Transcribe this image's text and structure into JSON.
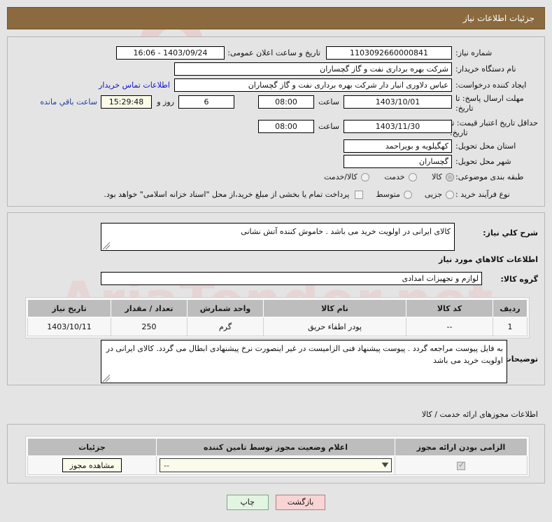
{
  "header": {
    "title": "جزئیات اطلاعات نیاز"
  },
  "form": {
    "need_number_label": "شماره نیاز:",
    "need_number_value": "1103092660000841",
    "announce_label": "تاریخ و ساعت اعلان عمومی:",
    "announce_value": "1403/09/24 - 16:06",
    "buyer_org_label": "نام دستگاه خریدار:",
    "buyer_org_value": "شرکت بهره برداری نفت و گاز گچساران",
    "requester_label": "ایجاد کننده درخواست:",
    "requester_value": "عباس دلاوری انبار دار شرکت بهره برداری نفت و گاز گچساران",
    "contact_link": "اطلاعات تماس خریدار",
    "deadline_label": "مهلت ارسال پاسخ: تا تاریخ:",
    "deadline_date": "1403/10/01",
    "hour_label": "ساعت",
    "deadline_time": "08:00",
    "days_remaining": "6",
    "days_and_label": "روز و",
    "clock_remaining": "15:29:48",
    "remaining_suffix": "ساعت باقي مانده",
    "price_validity_label": "حداقل تاریخ اعتبار قیمت: تا تاریخ:",
    "price_validity_date": "1403/11/30",
    "price_validity_time": "08:00",
    "province_label": "استان محل تحویل:",
    "province_value": "کهگیلویه و بویراحمد",
    "city_label": "شهر محل تحویل:",
    "city_value": "گچساران",
    "category_label": "طبقه بندی موضوعی:",
    "category_options": [
      {
        "label": "کالا",
        "selected": true
      },
      {
        "label": "خدمت",
        "selected": false
      },
      {
        "label": "کالا/خدمت",
        "selected": false
      }
    ],
    "process_label": "نوع فرآیند خرید :",
    "process_options": [
      {
        "label": "جزیی",
        "selected": false
      },
      {
        "label": "متوسط",
        "selected": false
      }
    ],
    "treasury_checkbox_checked": false,
    "treasury_text": "پرداخت تمام یا بخشی از مبلغ خرید،از محل \"اسناد خزانه اسلامی\" خواهد بود."
  },
  "summary": {
    "label": "شرح كلي نیاز:",
    "value": "کالای ایرانی در اولویت خرید می باشد . خاموش کننده آتش نشانی"
  },
  "goods_section": {
    "title": "اطلاعات كالاهاي مورد نیاز",
    "group_label": "گروه کالا:",
    "group_value": "لوازم و تجهیزات امدادی",
    "columns": [
      "ردیف",
      "کد کالا",
      "نام کالا",
      "واحد شمارش",
      "تعداد / مقدار",
      "تاریخ نیاز"
    ],
    "rows": [
      {
        "row": "1",
        "code": "--",
        "name": "پودر اطفاء حریق",
        "unit": "گرم",
        "qty": "250",
        "need_date": "1403/10/11"
      }
    ]
  },
  "buyer_notes": {
    "label": "توضیحات خریدار:",
    "value": "به فایل پیوست مراجعه گردد . پیوست پیشنهاد فنی الزامیست در غیر اینصورت نرخ پیشنهادی ابطال می گردد. کالای ایرانی در اولویت خرید می باشد"
  },
  "permits_section": {
    "title": "اطلاعات مجوزهای ارائه خدمت / کالا",
    "columns": [
      "الزامی بودن ارائه مجوز",
      "اعلام وضعیت مجوز توسط تامین کننده",
      "جزئیات"
    ],
    "rows": [
      {
        "required_checked": true,
        "status_value": "--",
        "details_button": "مشاهده مجوز"
      }
    ]
  },
  "footer": {
    "back_label": "بازگشت",
    "print_label": "چاپ"
  },
  "watermark": {
    "text": "AriaTender.net"
  },
  "colors": {
    "header_bar": "#8b6a3f",
    "link": "#1111cc",
    "back_button": "#f8d4d4",
    "print_button": "#e2f4e2",
    "table_header": "#bdbdbd"
  }
}
